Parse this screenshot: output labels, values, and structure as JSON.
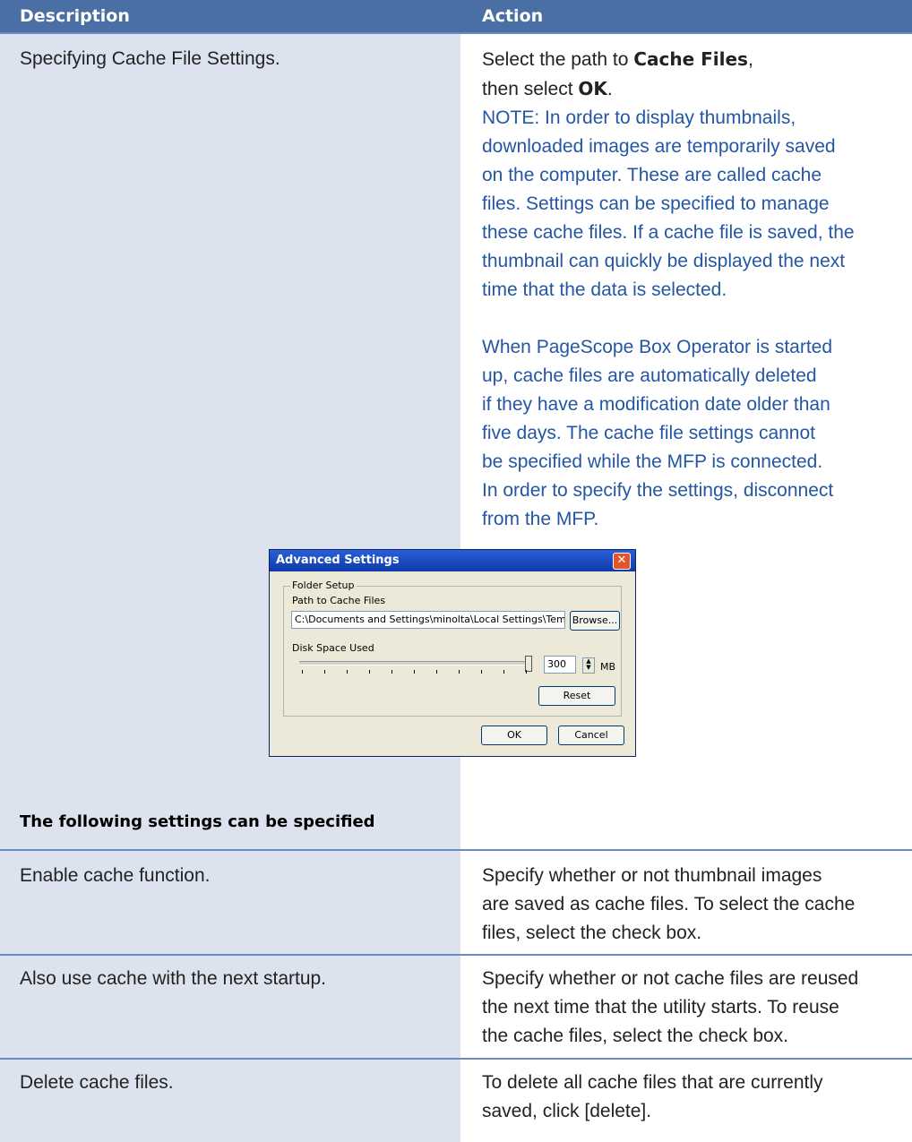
{
  "header": {
    "description": "Description",
    "action": "Action"
  },
  "main_row": {
    "description": "Specifying Cache File Settings.",
    "action_line1_prefix": "Select the path to ",
    "action_line1_bold": "Cache Files",
    "action_line1_suffix": ",",
    "action_line2_prefix": "then select ",
    "action_line2_bold": "OK",
    "action_line2_suffix": ".",
    "note1": [
      "NOTE: In order to display thumbnails,",
      "downloaded images are temporarily saved",
      "on the computer. These are called cache",
      "files. Settings can be specified to manage",
      "these cache files. If a cache file is saved, the",
      "thumbnail can quickly be displayed the next",
      "time that the data is selected."
    ],
    "note2": [
      "When PageScope Box Operator is started",
      "up, cache files are automatically deleted",
      "if they have a modification date older than",
      "five days. The cache file settings cannot",
      "be specified while the MFP is connected.",
      "In order to specify the settings, disconnect",
      "from the MFP."
    ]
  },
  "dialog": {
    "title": "Advanced Settings",
    "close_glyph": "✕",
    "group_label": "Folder Setup",
    "path_label": "Path to Cache Files",
    "path_value": "C:\\Documents and Settings\\minolta\\Local Settings\\Temp\\",
    "browse_label": "Browse...",
    "disk_label": "Disk Space Used",
    "disk_value": "300",
    "disk_unit": "MB",
    "slider_level": 1.0,
    "reset_label": "Reset",
    "ok_label": "OK",
    "cancel_label": "Cancel"
  },
  "subheader": "The following settings can be specified",
  "settings": [
    {
      "description": "Enable cache function.",
      "action": [
        "Specify whether or not thumbnail images",
        "are saved as cache files. To select the cache",
        "files, select the check box."
      ]
    },
    {
      "description": "Also use cache with the next startup.",
      "action": [
        "Specify whether or not cache files are reused",
        "the next time that the utility starts. To reuse",
        "the cache files, select the check box."
      ]
    },
    {
      "description": "Delete cache files.",
      "action": [
        "To delete all cache files that are currently",
        "saved, click [delete]."
      ]
    }
  ],
  "colors": {
    "header_bg": "#4a6fa5",
    "left_bg": "#dde3ee",
    "note_text": "#2456a4"
  }
}
